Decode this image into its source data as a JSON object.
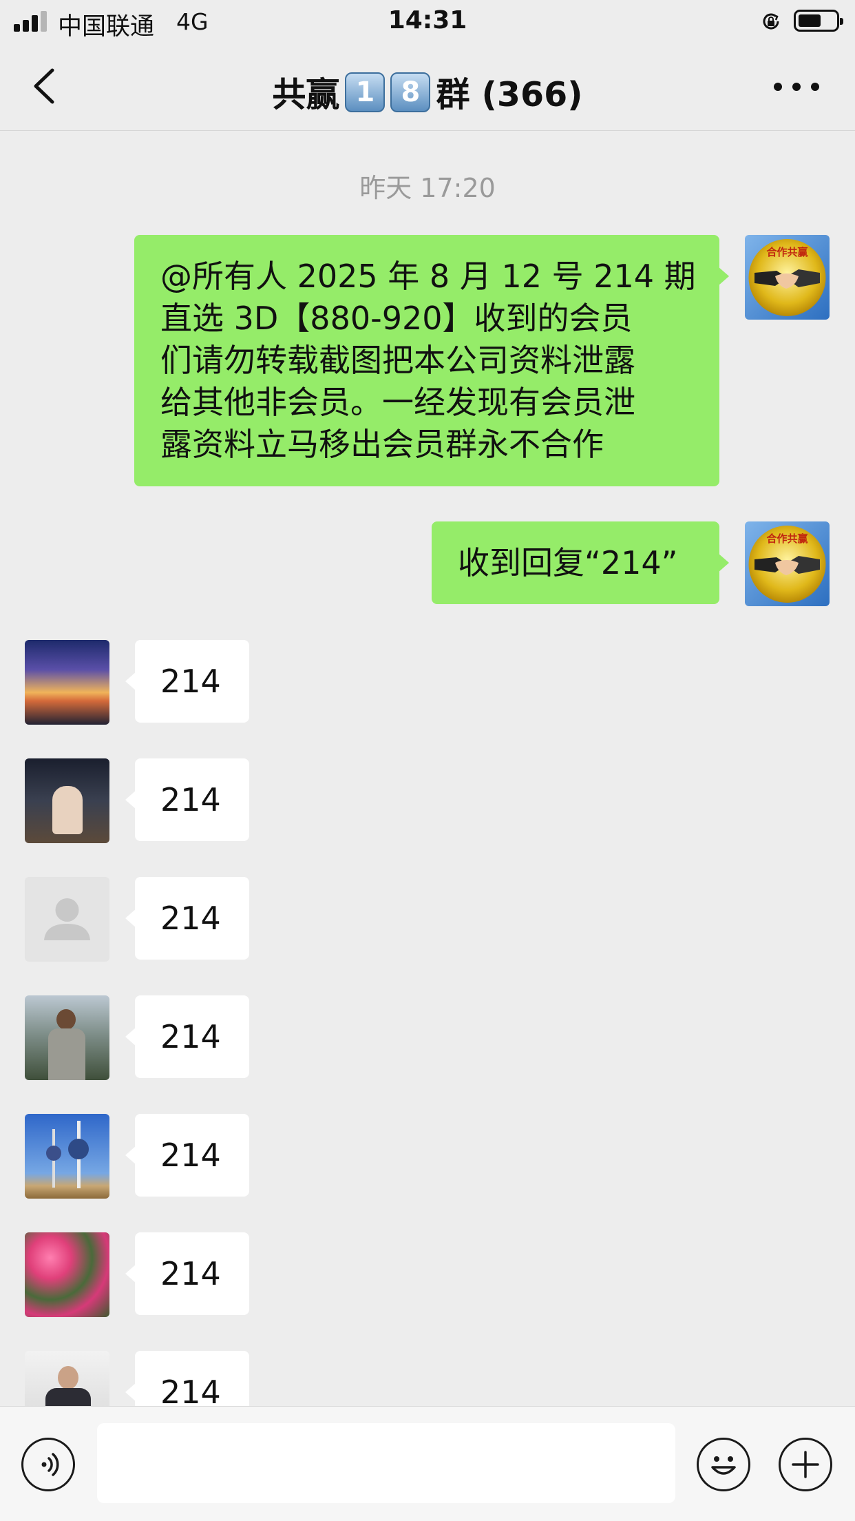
{
  "status_bar": {
    "carrier": "中国联通",
    "network": "4G",
    "time": "14:31",
    "battery_level_percent": 60
  },
  "nav": {
    "title_prefix": "共赢",
    "title_badges": [
      "1",
      "8"
    ],
    "title_suffix": "群 (366)",
    "back_icon": "chevron-left-icon",
    "more_icon": "more-dots-icon"
  },
  "chat": {
    "timestamp": "昨天 17:20",
    "messages": [
      {
        "direction": "outgoing",
        "text_lines": [
          "@所有人 2025 年 8 月 12 号 214 期",
          "直选 3D【880-920】收到的会员",
          "们请勿转载截图把本公司资料泄露",
          "给其他非会员。一经发现有会员泄",
          "露资料立马移出会员群永不合作"
        ],
        "avatar": "handshake-logo-avatar",
        "avatar_text": "合作共赢"
      },
      {
        "direction": "outgoing",
        "text": "收到回复“214”",
        "avatar": "handshake-logo-avatar",
        "avatar_text": "合作共赢"
      },
      {
        "direction": "incoming",
        "text": "214",
        "avatar": "sunset-sky-avatar"
      },
      {
        "direction": "incoming",
        "text": "214",
        "avatar": "family-night-avatar"
      },
      {
        "direction": "incoming",
        "text": "214",
        "avatar": "default-user-avatar"
      },
      {
        "direction": "incoming",
        "text": "214",
        "avatar": "man-outdoor-avatar"
      },
      {
        "direction": "incoming",
        "text": "214",
        "avatar": "towers-avatar"
      },
      {
        "direction": "incoming",
        "text": "214",
        "avatar": "pink-flowers-avatar"
      },
      {
        "direction": "incoming",
        "text": "214",
        "avatar": "man-office-avatar"
      }
    ]
  },
  "input_bar": {
    "voice_icon": "voice-icon",
    "emoji_icon": "emoji-icon",
    "plus_icon": "plus-icon",
    "input_value": ""
  },
  "colors": {
    "background": "#ededed",
    "outgoing_bubble": "#95ec69",
    "incoming_bubble": "#ffffff",
    "timestamp": "#9a9a9a"
  }
}
